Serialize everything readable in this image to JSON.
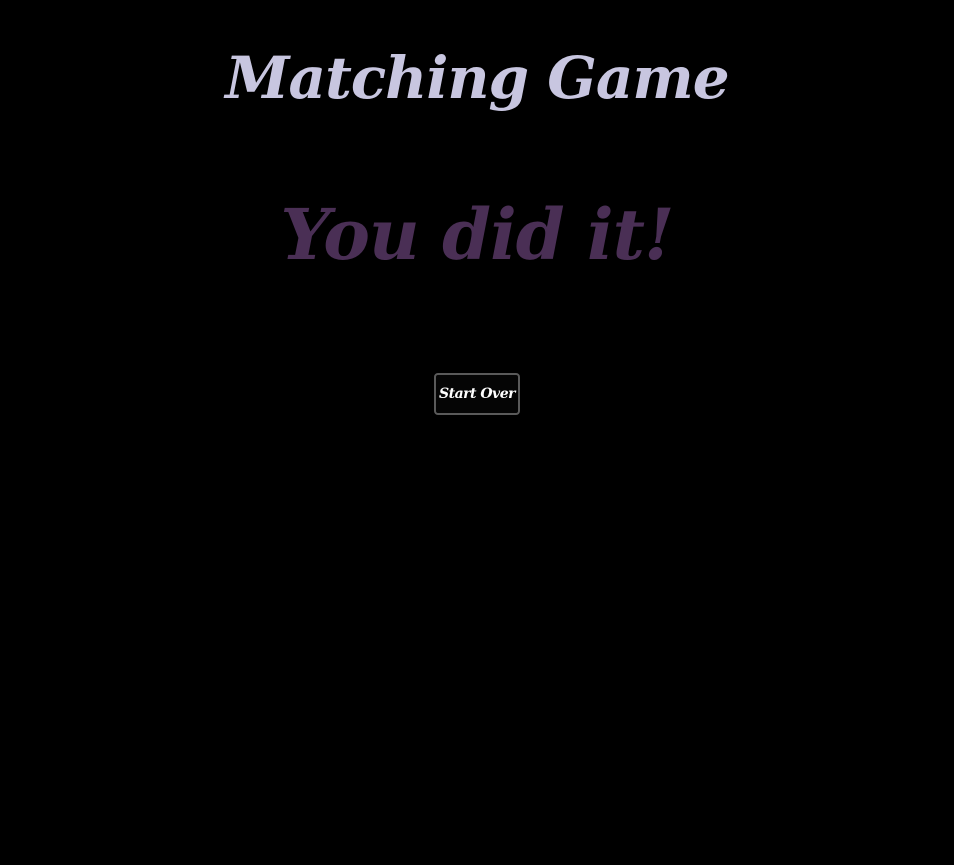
{
  "game": {
    "title": "Matching Game",
    "status_message": "You did it!",
    "start_over_label": "Start Over"
  },
  "colors": {
    "background": "#000000",
    "title": "#c8c6e0",
    "status_message": "#4a2f55",
    "button_text": "#ffffff",
    "button_border": "#5a5a5a"
  }
}
